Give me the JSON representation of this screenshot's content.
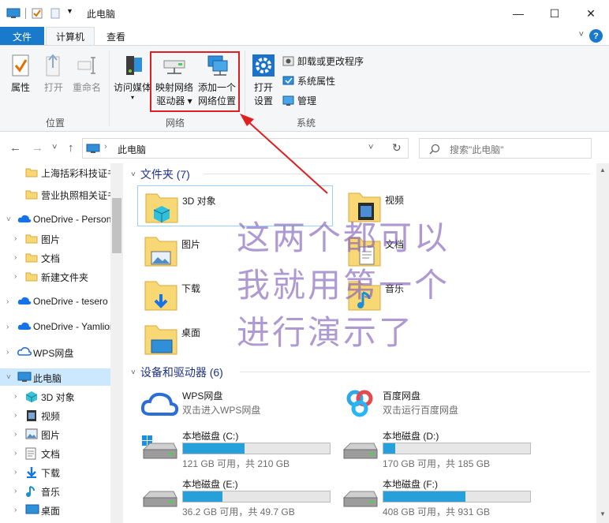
{
  "window": {
    "title": "此电脑",
    "minimize": "—",
    "maximize": "☐",
    "close": "✕"
  },
  "ribbon_tabs": {
    "file": "文件",
    "computer": "计算机",
    "view": "查看",
    "collapse": "˅",
    "help": "?"
  },
  "ribbon": {
    "location": {
      "label": "位置",
      "properties": "属性",
      "open": "打开",
      "rename": "重命名"
    },
    "network": {
      "label": "网络",
      "access_media": "访问媒体",
      "map_drive_line1": "映射网络",
      "map_drive_line2": "驱动器 ▾",
      "add_location_line1": "添加一个",
      "add_location_line2": "网络位置"
    },
    "system": {
      "label": "系统",
      "open_settings_line1": "打开",
      "open_settings_line2": "设置",
      "uninstall": "卸载或更改程序",
      "system_properties": "系统属性",
      "manage": "管理"
    }
  },
  "annotation": {
    "line1": "这两个都可以",
    "line2": "我就用第一个",
    "line3": "进行演示了",
    "color": "#7e5ab6"
  },
  "address": {
    "back": "←",
    "forward": "→",
    "recent": "˅",
    "up": "↑",
    "path": "此电脑",
    "dropdown": "˅",
    "refresh": "↻",
    "search_placeholder": "搜索\"此电脑\""
  },
  "nav": {
    "items": [
      {
        "label": "上海括彩科技证书",
        "icon": "folder-icon"
      },
      {
        "label": "营业执照相关证书",
        "icon": "folder-icon"
      },
      {
        "label": "OneDrive - Personal",
        "icon": "cloud-icon"
      },
      {
        "label": "图片",
        "icon": "folder-icon"
      },
      {
        "label": "文档",
        "icon": "folder-icon"
      },
      {
        "label": "新建文件夹",
        "icon": "folder-icon"
      },
      {
        "label": "OneDrive - tesero",
        "icon": "cloud-icon"
      },
      {
        "label": "OneDrive - Yamlion",
        "icon": "cloud-icon"
      },
      {
        "label": "WPS网盘",
        "icon": "wps-cloud-icon"
      },
      {
        "label": "此电脑",
        "icon": "computer-icon"
      },
      {
        "label": "3D 对象",
        "icon": "cube-icon"
      },
      {
        "label": "视频",
        "icon": "video-icon"
      },
      {
        "label": "图片",
        "icon": "picture-icon"
      },
      {
        "label": "文档",
        "icon": "document-icon"
      },
      {
        "label": "下载",
        "icon": "download-icon"
      },
      {
        "label": "音乐",
        "icon": "music-icon"
      },
      {
        "label": "桌面",
        "icon": "desktop-icon"
      }
    ]
  },
  "content": {
    "folders_header": "文件夹 (7)",
    "folders": [
      {
        "label": "3D 对象"
      },
      {
        "label": "视频"
      },
      {
        "label": "图片"
      },
      {
        "label": "文档"
      },
      {
        "label": "下载"
      },
      {
        "label": "音乐"
      },
      {
        "label": "桌面"
      }
    ],
    "devices_header": "设备和驱动器 (6)",
    "clouds": [
      {
        "name": "WPS网盘",
        "sub": "双击进入WPS网盘"
      },
      {
        "name": "百度网盘",
        "sub": "双击运行百度网盘"
      }
    ],
    "drives": [
      {
        "name": "本地磁盘 (C:)",
        "space": "121 GB 可用，共 210 GB",
        "used_fraction": 0.42
      },
      {
        "name": "本地磁盘 (D:)",
        "space": "170 GB 可用，共 185 GB",
        "used_fraction": 0.08
      },
      {
        "name": "本地磁盘 (E:)",
        "space": "36.2 GB 可用，共 49.7 GB",
        "used_fraction": 0.27
      },
      {
        "name": "本地磁盘 (F:)",
        "space": "408 GB 可用，共 931 GB",
        "used_fraction": 0.56
      }
    ]
  }
}
